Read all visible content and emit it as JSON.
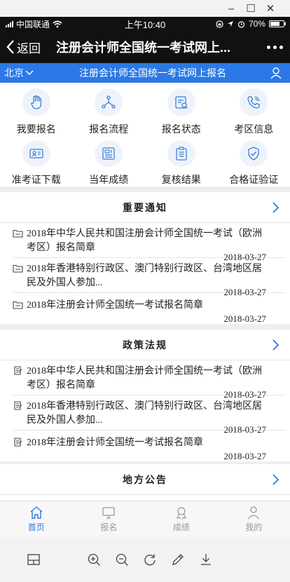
{
  "window": {
    "minimize": "–",
    "maximize": "☐",
    "close": "✕"
  },
  "status": {
    "carrier": "中国联通",
    "time": "上午10:40",
    "battery": "70%"
  },
  "nav": {
    "back": "返回",
    "title": "注册会计师全国统一考试网上..."
  },
  "header": {
    "city": "北京",
    "title": "注册会计师全国统一考试网上报名"
  },
  "grid": [
    {
      "label": "我要报名",
      "icon": "hand-icon"
    },
    {
      "label": "报名流程",
      "icon": "flow-icon"
    },
    {
      "label": "报名状态",
      "icon": "status-icon"
    },
    {
      "label": "考区信息",
      "icon": "phone-icon"
    },
    {
      "label": "准考证下载",
      "icon": "id-card-icon"
    },
    {
      "label": "当年成绩",
      "icon": "score-icon"
    },
    {
      "label": "复核结果",
      "icon": "clipboard-icon"
    },
    {
      "label": "合格证验证",
      "icon": "shield-icon"
    }
  ],
  "notices": {
    "title": "重要通知",
    "items": [
      {
        "text": "2018年中华人民共和国注册会计师全国统一考试（欧洲考区）报名简章",
        "date": "2018-03-27"
      },
      {
        "text": "2018年香港特别行政区、澳门特别行政区、台湾地区居民及外国人参加...",
        "date": "2018-03-27"
      },
      {
        "text": "2018年注册会计师全国统一考试报名简章",
        "date": "2018-03-27"
      }
    ]
  },
  "policies": {
    "title": "政策法规",
    "items": [
      {
        "text": "2018年中华人民共和国注册会计师全国统一考试（欧洲考区）报名简章",
        "date": "2018-03-27"
      },
      {
        "text": "2018年香港特别行政区、澳门特别行政区、台湾地区居民及外国人参加...",
        "date": "2018-03-27"
      },
      {
        "text": "2018年注册会计师全国统一考试报名简章",
        "date": "2018-03-27"
      }
    ]
  },
  "local": {
    "title": "地方公告"
  },
  "tabs": [
    {
      "label": "首页",
      "icon": "home-icon",
      "active": true
    },
    {
      "label": "报名",
      "icon": "monitor-icon",
      "active": false
    },
    {
      "label": "成绩",
      "icon": "medal-icon",
      "active": false
    },
    {
      "label": "我的",
      "icon": "person-icon",
      "active": false
    }
  ],
  "colors": {
    "accent": "#2a79e6",
    "dark": "#111111"
  }
}
